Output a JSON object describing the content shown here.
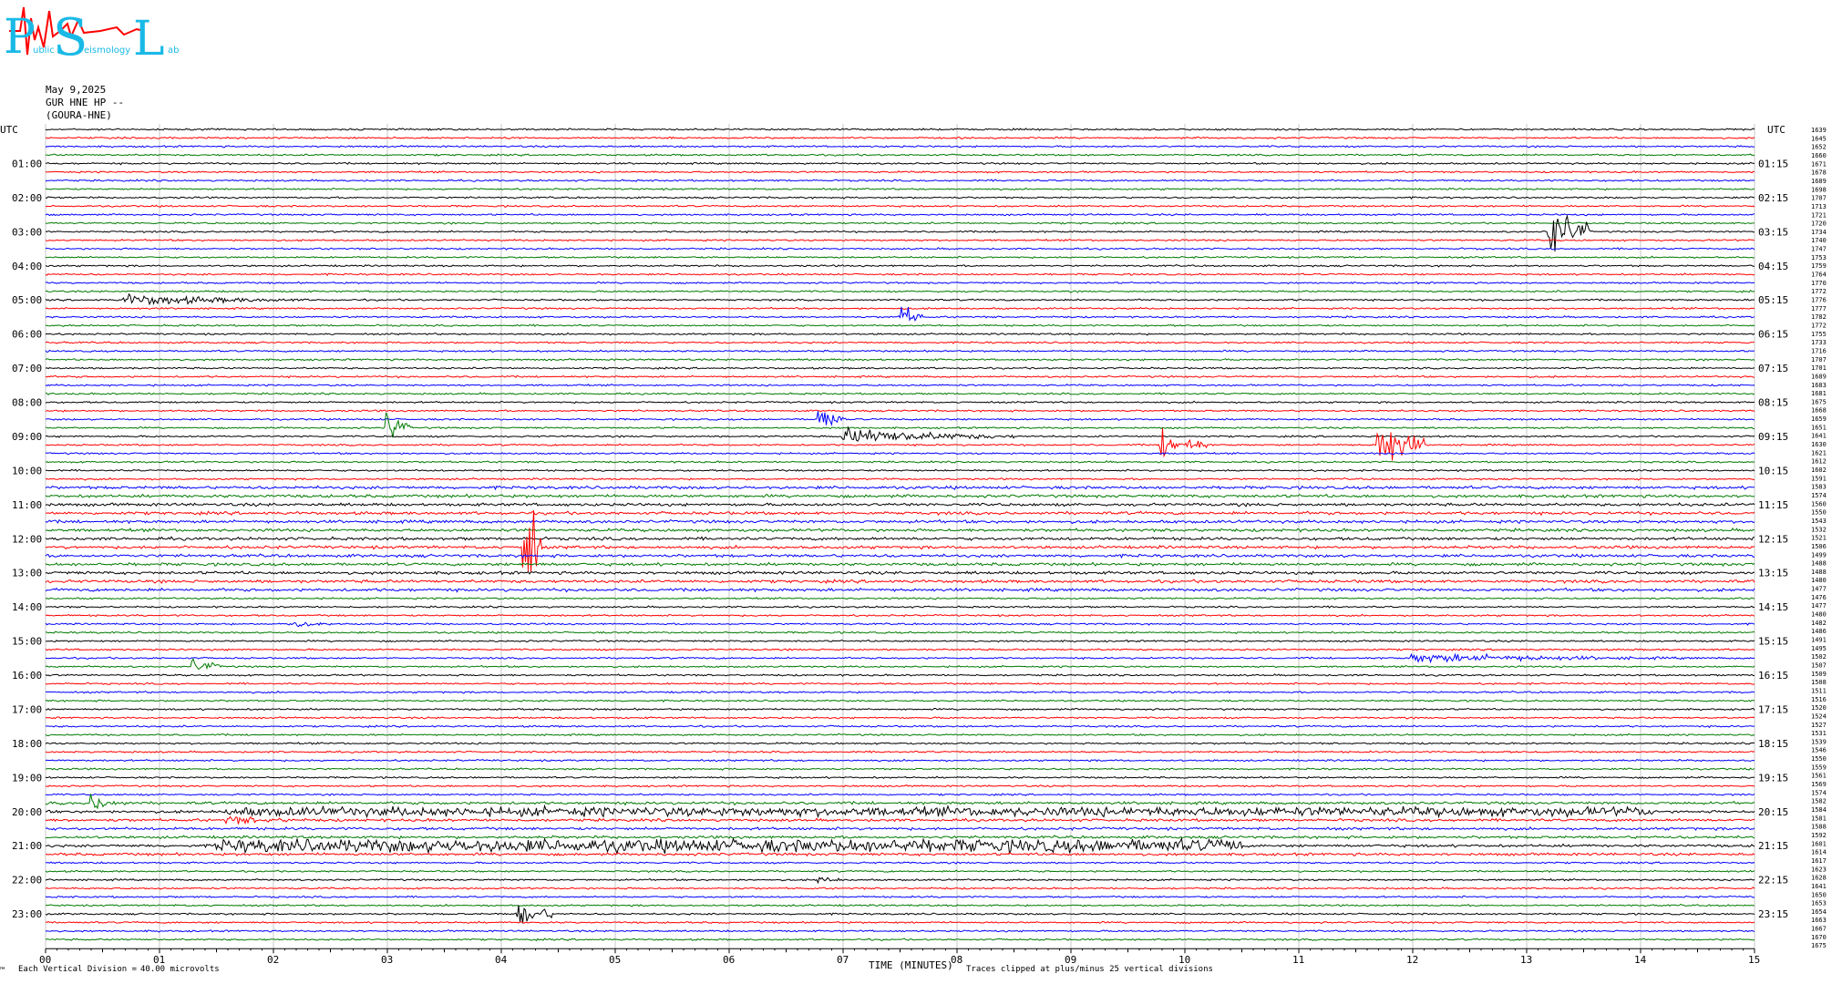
{
  "header": {
    "date": "May 9,2025",
    "station": "GUR HNE HP --",
    "network": "(GOURA-HNE)"
  },
  "logo": {
    "big_letters": [
      "P",
      "S",
      "L"
    ],
    "small_text": [
      "ublic",
      "eismology",
      "ab"
    ],
    "colors": {
      "letters": "#19b9e6",
      "trace": "#ff0000"
    }
  },
  "footer": {
    "scale_prefix": "Each Vertical Division =",
    "scale_value": "40.00 microvolts",
    "clip_note": "Traces clipped at plus/minus 25 vertical divisions",
    "corner_mark": "™"
  },
  "chart_data": {
    "type": "line",
    "title": "",
    "xlabel": "TIME (MINUTES)",
    "ylabel_left": "UTC",
    "ylabel_right": "UTC",
    "xlim": [
      0,
      15
    ],
    "x_ticks": [
      "00",
      "01",
      "02",
      "03",
      "04",
      "05",
      "06",
      "07",
      "08",
      "09",
      "10",
      "11",
      "12",
      "13",
      "14",
      "15"
    ],
    "left_labels": [
      "01:00",
      "02:00",
      "03:00",
      "04:00",
      "05:00",
      "06:00",
      "07:00",
      "08:00",
      "09:00",
      "10:00",
      "11:00",
      "12:00",
      "13:00",
      "14:00",
      "15:00",
      "16:00",
      "17:00",
      "18:00",
      "19:00",
      "20:00",
      "21:00",
      "22:00",
      "23:00"
    ],
    "right_labels": [
      "01:15",
      "02:15",
      "03:15",
      "04:15",
      "05:15",
      "06:15",
      "07:15",
      "08:15",
      "09:15",
      "10:15",
      "11:15",
      "12:15",
      "13:15",
      "14:15",
      "15:15",
      "16:15",
      "17:15",
      "18:15",
      "19:15",
      "20:15",
      "21:15",
      "22:15",
      "23:15"
    ],
    "trace_colors": [
      "#000000",
      "#ff0000",
      "#0000ff",
      "#007a00"
    ],
    "trace_interval_minutes": 15,
    "trace_count": 96,
    "right_values": [
      1639,
      1645,
      1652,
      1660,
      1671,
      1678,
      1689,
      1698,
      1707,
      1713,
      1721,
      1720,
      1734,
      1740,
      1747,
      1753,
      1759,
      1764,
      1770,
      1772,
      1776,
      1777,
      1782,
      1772,
      1755,
      1733,
      1716,
      1707,
      1701,
      1689,
      1683,
      1681,
      1675,
      1668,
      1659,
      1651,
      1641,
      1630,
      1621,
      1612,
      1602,
      1591,
      1583,
      1574,
      1560,
      1550,
      1543,
      1532,
      1521,
      1506,
      1499,
      1488,
      1488,
      1480,
      1477,
      1476,
      1477,
      1480,
      1482,
      1486,
      1491,
      1495,
      1502,
      1507,
      1509,
      1508,
      1511,
      1516,
      1520,
      1524,
      1527,
      1531,
      1539,
      1546,
      1550,
      1559,
      1561,
      1569,
      1574,
      1582,
      1584,
      1581,
      1588,
      1592,
      1601,
      1614,
      1617,
      1623,
      1628,
      1641,
      1650,
      1653,
      1654,
      1663,
      1667,
      1670,
      1675
    ],
    "events": [
      {
        "trace": 12,
        "minute": 13.2,
        "amplitude": 50,
        "duration_min": 0.35,
        "note": "clipped"
      },
      {
        "trace": 20,
        "minute": 0.7,
        "amplitude": 10,
        "duration_min": 1.6
      },
      {
        "trace": 22,
        "minute": 7.5,
        "amplitude": 22,
        "duration_min": 0.2
      },
      {
        "trace": 35,
        "minute": 3.0,
        "amplitude": 28,
        "duration_min": 0.2
      },
      {
        "trace": 34,
        "minute": 6.8,
        "amplitude": 26,
        "duration_min": 0.2
      },
      {
        "trace": 36,
        "minute": 7.0,
        "amplitude": 14,
        "duration_min": 1.5
      },
      {
        "trace": 37,
        "minute": 9.8,
        "amplitude": 25,
        "duration_min": 0.4
      },
      {
        "trace": 37,
        "minute": 11.7,
        "amplitude": 45,
        "duration_min": 0.4
      },
      {
        "trace": 49,
        "minute": 4.2,
        "amplitude": 120,
        "duration_min": 0.15,
        "note": "clipped"
      },
      {
        "trace": 58,
        "minute": 2.2,
        "amplitude": 9,
        "duration_min": 0.3
      },
      {
        "trace": 62,
        "minute": 12.0,
        "amplitude": 8,
        "duration_min": 2.5
      },
      {
        "trace": 63,
        "minute": 1.3,
        "amplitude": 12,
        "duration_min": 0.3
      },
      {
        "trace": 79,
        "minute": 0.4,
        "amplitude": 16,
        "duration_min": 0.3
      },
      {
        "trace": 80,
        "minute": 1.6,
        "amplitude": 7,
        "duration_min": 12.5
      },
      {
        "trace": 81,
        "minute": 1.6,
        "amplitude": 7,
        "duration_min": 1.0
      },
      {
        "trace": 84,
        "minute": 1.5,
        "amplitude": 10,
        "duration_min": 9.0
      },
      {
        "trace": 88,
        "minute": 6.8,
        "amplitude": 8,
        "duration_min": 0.2
      },
      {
        "trace": 92,
        "minute": 4.15,
        "amplitude": 28,
        "duration_min": 0.3
      }
    ]
  }
}
